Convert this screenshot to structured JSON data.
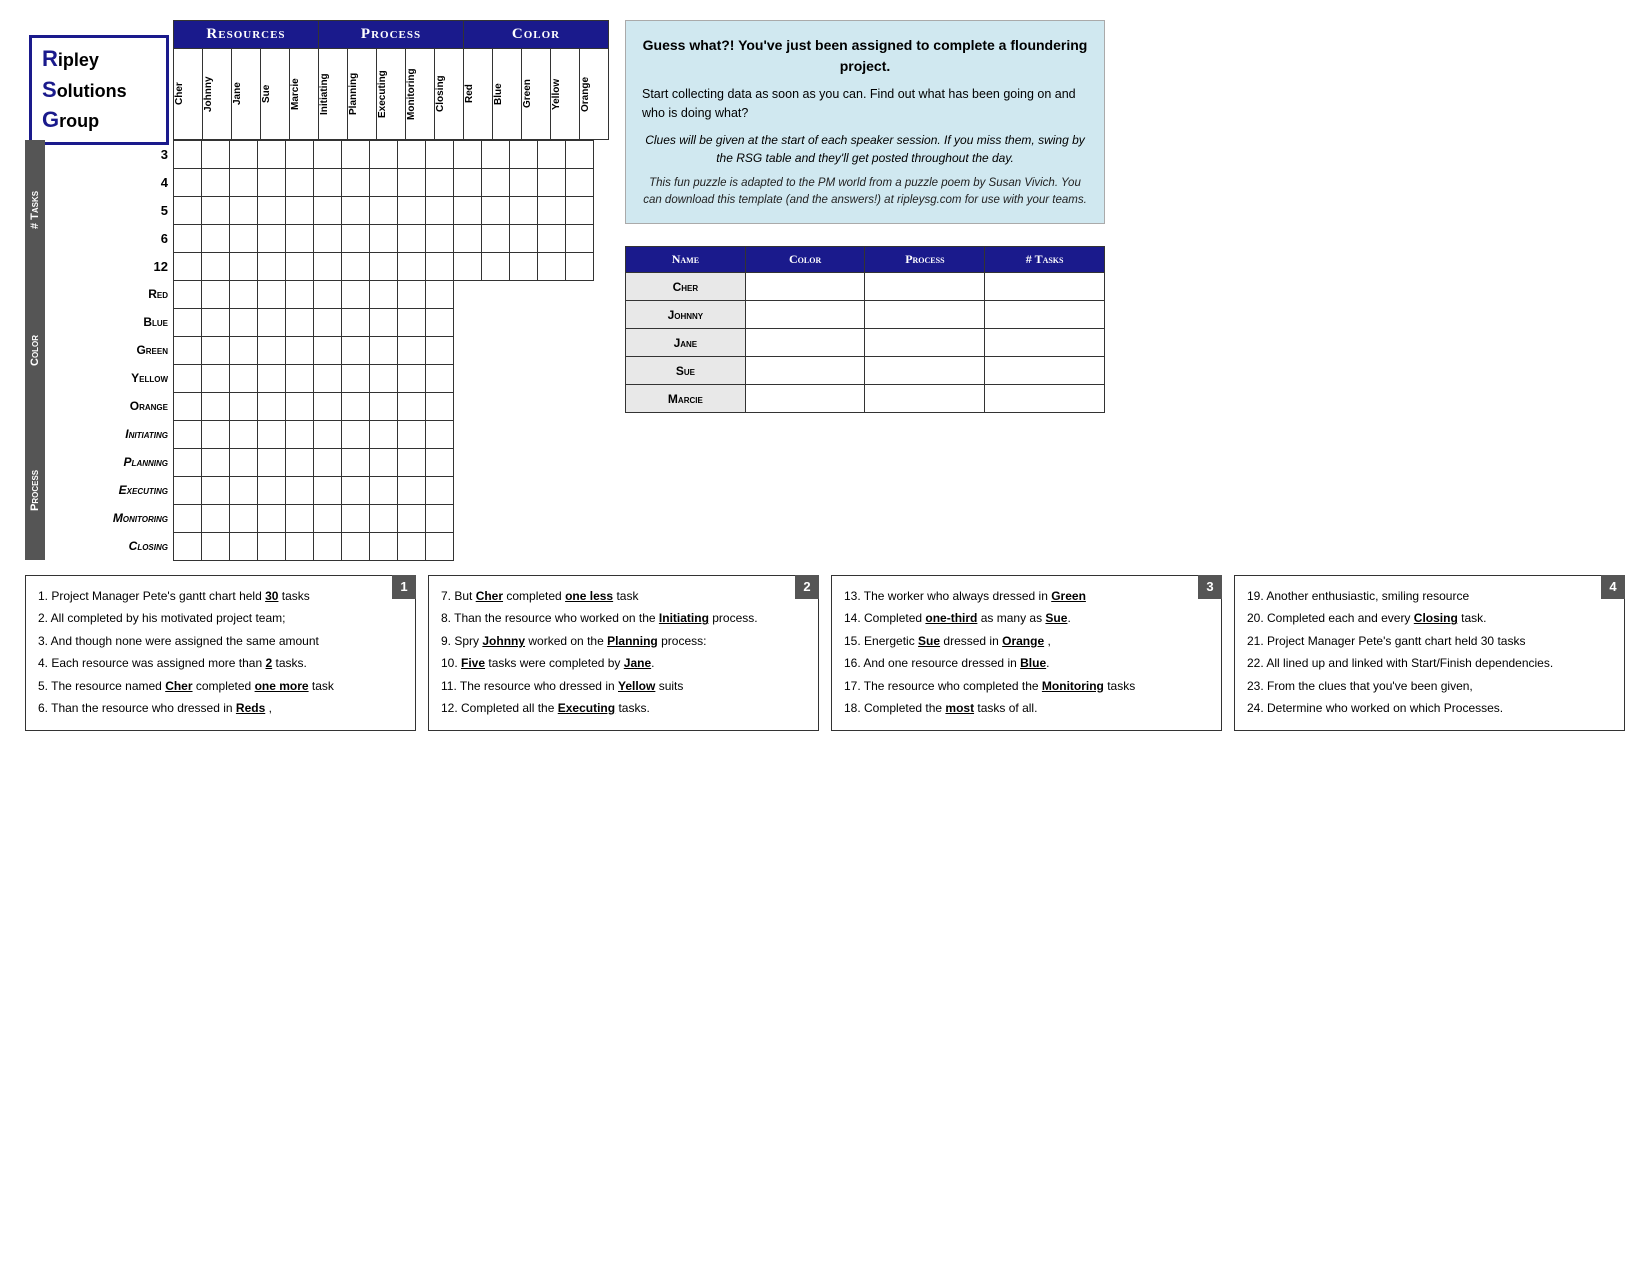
{
  "logo": {
    "line1": "ipley",
    "line2": "olutions",
    "line3": "roup",
    "r": "R",
    "s": "S",
    "g": "G"
  },
  "grid_headers": {
    "resources_label": "Resources",
    "process_label": "Process",
    "color_label": "Color",
    "col_headers": [
      "Cher",
      "Johnny",
      "Jane",
      "Sue",
      "Marcie",
      "Initiating",
      "Planning",
      "Executing",
      "Monitoring",
      "Closing",
      "Red",
      "Blue",
      "Green",
      "Yellow",
      "Orange"
    ]
  },
  "row_groups": {
    "tasks": {
      "label": "# Tasks",
      "rows": [
        "3",
        "4",
        "5",
        "6",
        "12"
      ]
    },
    "color": {
      "label": "Color",
      "rows": [
        "Red",
        "Blue",
        "Green",
        "Yellow",
        "Orange"
      ]
    },
    "process": {
      "label": "Process",
      "rows": [
        "Initiating",
        "Planning",
        "Executing",
        "Monitoring",
        "Closing"
      ]
    }
  },
  "info_box": {
    "headline": "Guess what?! You've just been assigned to complete a floundering project.",
    "body1": "Start collecting data as soon as you can.  Find out what has been going on and who is doing what?",
    "italic_note": "Clues will be given at the start of each speaker session.  If you miss them, swing by the RSG table and they'll get posted throughout the day.",
    "footnote": "This fun puzzle is adapted to the PM world from a puzzle poem by Susan Vivich.  You can download this template (and the answers!) at ripleysg.com for use with your teams."
  },
  "answer_table": {
    "headers": [
      "Name",
      "Color",
      "Process",
      "# Tasks"
    ],
    "rows": [
      {
        "name": "Cher",
        "color": "",
        "process": "",
        "tasks": ""
      },
      {
        "name": "Johnny",
        "color": "",
        "process": "",
        "tasks": ""
      },
      {
        "name": "Jane",
        "color": "",
        "process": "",
        "tasks": ""
      },
      {
        "name": "Sue",
        "color": "",
        "process": "",
        "tasks": ""
      },
      {
        "name": "Marcie",
        "color": "",
        "process": "",
        "tasks": ""
      }
    ]
  },
  "clue_groups": [
    {
      "badge": "1",
      "clues": [
        "1.  Project Manager Pete's gantt chart held __30__ tasks",
        "2.  All completed by his motivated project team;",
        "3.  And though none were assigned the same amount",
        "4.  Each resource was assigned more than __2____ tasks.",
        "5.  The resource named __Cher__ completed _one more_task",
        "6.  Than the resource who dressed in __Reds___ ,"
      ]
    },
    {
      "badge": "2",
      "clues": [
        "7.  But __Cher_ completed _one less_____ task",
        "8.  Than the resource who worked on the _Initiating_ process.",
        "9.  Spry __Johnny_ worked on the _Planning_ process:",
        "10. _Five_ tasks were completed by _Jane____.",
        "11. The resource who dressed in _Yellow_ suits",
        "12. Completed all the _Executing___ tasks."
      ]
    },
    {
      "badge": "3",
      "clues": [
        "13. The worker who always dressed in _Green____",
        "14. Completed _one-third_ as many as _Sue_____.",
        "15. Energetic _Sue__ dressed in _Orange____ ,",
        "16. And one resource dressed in _Blue____.",
        "17. The resource who completed the __Monitoring_ tasks",
        "18. Completed the _most_ tasks of all."
      ]
    },
    {
      "badge": "4",
      "clues": [
        "19. Another enthusiastic, smiling resource",
        "20. Completed each and every _Closing____ task.",
        "21. Project Manager Pete's gantt chart held 30 tasks",
        "22. All lined up and linked with Start/Finish dependencies.",
        "23. From the clues that you've been given,",
        "24. Determine who worked on which Processes."
      ]
    }
  ],
  "colors": {
    "header_bg": "#1a1a8c",
    "side_label_bg": "#555555",
    "info_bg": "#c8dff0",
    "badge_bg": "#666666"
  }
}
